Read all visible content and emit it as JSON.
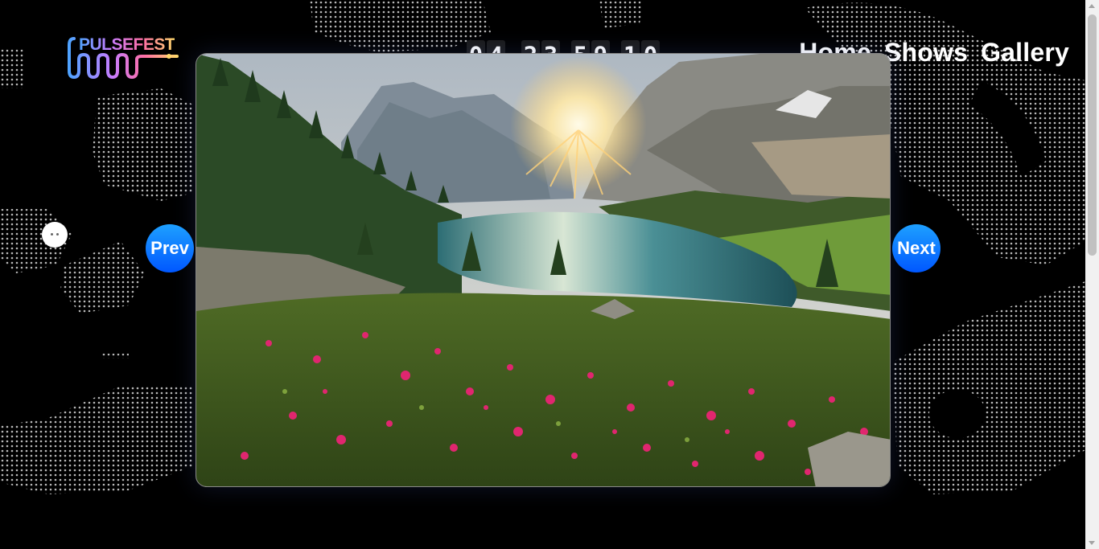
{
  "brand": {
    "logo_text": "PULSEFEST"
  },
  "countdown": {
    "days": [
      "0",
      "4"
    ],
    "hours": [
      "2",
      "3"
    ],
    "minutes": [
      "5",
      "9"
    ],
    "seconds": [
      "1",
      "0"
    ]
  },
  "nav": {
    "items": [
      "Home",
      "Shows",
      "Gallery"
    ]
  },
  "gallery": {
    "prev_label": "Prev",
    "next_label": "Next",
    "image_alt": "Mountain lake with sunrise and pink alpine flowers"
  },
  "colors": {
    "button_top": "#1ea0ff",
    "button_bottom": "#0057ff",
    "background": "#000000"
  }
}
